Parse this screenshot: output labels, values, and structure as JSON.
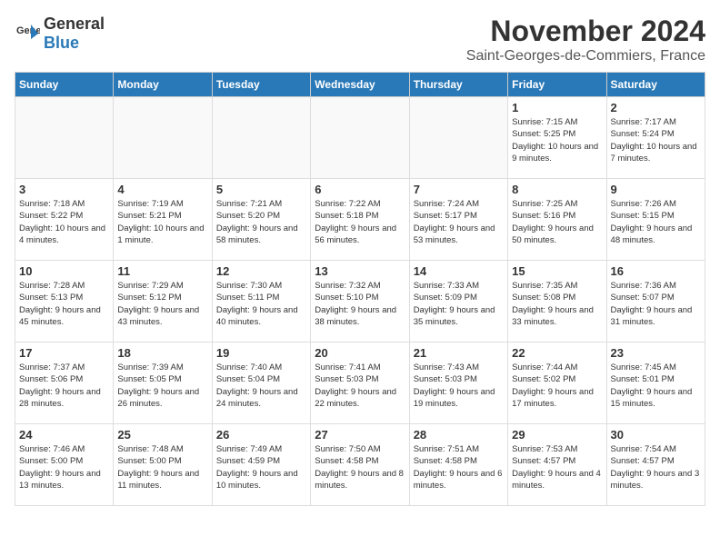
{
  "header": {
    "logo_general": "General",
    "logo_blue": "Blue",
    "title": "November 2024",
    "subtitle": "Saint-Georges-de-Commiers, France"
  },
  "weekdays": [
    "Sunday",
    "Monday",
    "Tuesday",
    "Wednesday",
    "Thursday",
    "Friday",
    "Saturday"
  ],
  "weeks": [
    [
      {
        "day": "",
        "empty": true
      },
      {
        "day": "",
        "empty": true
      },
      {
        "day": "",
        "empty": true
      },
      {
        "day": "",
        "empty": true
      },
      {
        "day": "",
        "empty": true
      },
      {
        "day": "1",
        "sunrise": "7:15 AM",
        "sunset": "5:25 PM",
        "daylight": "10 hours and 9 minutes."
      },
      {
        "day": "2",
        "sunrise": "7:17 AM",
        "sunset": "5:24 PM",
        "daylight": "10 hours and 7 minutes."
      }
    ],
    [
      {
        "day": "3",
        "sunrise": "7:18 AM",
        "sunset": "5:22 PM",
        "daylight": "10 hours and 4 minutes."
      },
      {
        "day": "4",
        "sunrise": "7:19 AM",
        "sunset": "5:21 PM",
        "daylight": "10 hours and 1 minute."
      },
      {
        "day": "5",
        "sunrise": "7:21 AM",
        "sunset": "5:20 PM",
        "daylight": "9 hours and 58 minutes."
      },
      {
        "day": "6",
        "sunrise": "7:22 AM",
        "sunset": "5:18 PM",
        "daylight": "9 hours and 56 minutes."
      },
      {
        "day": "7",
        "sunrise": "7:24 AM",
        "sunset": "5:17 PM",
        "daylight": "9 hours and 53 minutes."
      },
      {
        "day": "8",
        "sunrise": "7:25 AM",
        "sunset": "5:16 PM",
        "daylight": "9 hours and 50 minutes."
      },
      {
        "day": "9",
        "sunrise": "7:26 AM",
        "sunset": "5:15 PM",
        "daylight": "9 hours and 48 minutes."
      }
    ],
    [
      {
        "day": "10",
        "sunrise": "7:28 AM",
        "sunset": "5:13 PM",
        "daylight": "9 hours and 45 minutes."
      },
      {
        "day": "11",
        "sunrise": "7:29 AM",
        "sunset": "5:12 PM",
        "daylight": "9 hours and 43 minutes."
      },
      {
        "day": "12",
        "sunrise": "7:30 AM",
        "sunset": "5:11 PM",
        "daylight": "9 hours and 40 minutes."
      },
      {
        "day": "13",
        "sunrise": "7:32 AM",
        "sunset": "5:10 PM",
        "daylight": "9 hours and 38 minutes."
      },
      {
        "day": "14",
        "sunrise": "7:33 AM",
        "sunset": "5:09 PM",
        "daylight": "9 hours and 35 minutes."
      },
      {
        "day": "15",
        "sunrise": "7:35 AM",
        "sunset": "5:08 PM",
        "daylight": "9 hours and 33 minutes."
      },
      {
        "day": "16",
        "sunrise": "7:36 AM",
        "sunset": "5:07 PM",
        "daylight": "9 hours and 31 minutes."
      }
    ],
    [
      {
        "day": "17",
        "sunrise": "7:37 AM",
        "sunset": "5:06 PM",
        "daylight": "9 hours and 28 minutes."
      },
      {
        "day": "18",
        "sunrise": "7:39 AM",
        "sunset": "5:05 PM",
        "daylight": "9 hours and 26 minutes."
      },
      {
        "day": "19",
        "sunrise": "7:40 AM",
        "sunset": "5:04 PM",
        "daylight": "9 hours and 24 minutes."
      },
      {
        "day": "20",
        "sunrise": "7:41 AM",
        "sunset": "5:03 PM",
        "daylight": "9 hours and 22 minutes."
      },
      {
        "day": "21",
        "sunrise": "7:43 AM",
        "sunset": "5:03 PM",
        "daylight": "9 hours and 19 minutes."
      },
      {
        "day": "22",
        "sunrise": "7:44 AM",
        "sunset": "5:02 PM",
        "daylight": "9 hours and 17 minutes."
      },
      {
        "day": "23",
        "sunrise": "7:45 AM",
        "sunset": "5:01 PM",
        "daylight": "9 hours and 15 minutes."
      }
    ],
    [
      {
        "day": "24",
        "sunrise": "7:46 AM",
        "sunset": "5:00 PM",
        "daylight": "9 hours and 13 minutes."
      },
      {
        "day": "25",
        "sunrise": "7:48 AM",
        "sunset": "5:00 PM",
        "daylight": "9 hours and 11 minutes."
      },
      {
        "day": "26",
        "sunrise": "7:49 AM",
        "sunset": "4:59 PM",
        "daylight": "9 hours and 10 minutes."
      },
      {
        "day": "27",
        "sunrise": "7:50 AM",
        "sunset": "4:58 PM",
        "daylight": "9 hours and 8 minutes."
      },
      {
        "day": "28",
        "sunrise": "7:51 AM",
        "sunset": "4:58 PM",
        "daylight": "9 hours and 6 minutes."
      },
      {
        "day": "29",
        "sunrise": "7:53 AM",
        "sunset": "4:57 PM",
        "daylight": "9 hours and 4 minutes."
      },
      {
        "day": "30",
        "sunrise": "7:54 AM",
        "sunset": "4:57 PM",
        "daylight": "9 hours and 3 minutes."
      }
    ]
  ]
}
